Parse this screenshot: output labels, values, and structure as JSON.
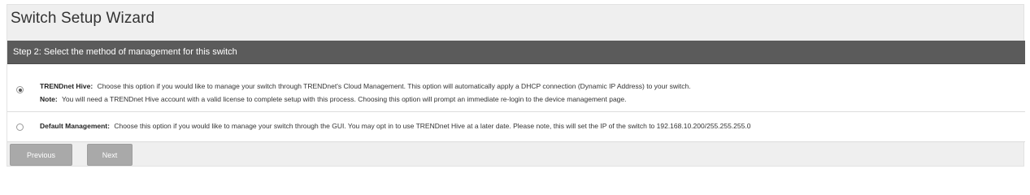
{
  "wizard": {
    "title": "Switch Setup Wizard",
    "step_label": "Step 2: Select the method of management for this switch"
  },
  "options": [
    {
      "selected": true,
      "label": "TRENDnet Hive:",
      "description": "Choose this option if you would like to manage your switch through TRENDnet's Cloud Management. This option will automatically apply a DHCP connection (Dynamic IP Address) to your switch.",
      "note_label": "Note:",
      "note": "You will need a TRENDnet Hive account with a valid license to complete setup with this process. Choosing this option will prompt an immediate re-login to the device management page."
    },
    {
      "selected": false,
      "label": "Default Management:",
      "description": "Choose this option if you would like to manage your switch through the GUI. You may opt in to use TRENDnet Hive at a later date. Please note, this will set the IP of the switch to 192.168.10.200/255.255.255.0"
    }
  ],
  "buttons": {
    "previous": "Previous",
    "next": "Next"
  },
  "colors": {
    "step_bar": "#5b5b5b",
    "button": "#a9a9a9",
    "panel": "#efefef"
  }
}
